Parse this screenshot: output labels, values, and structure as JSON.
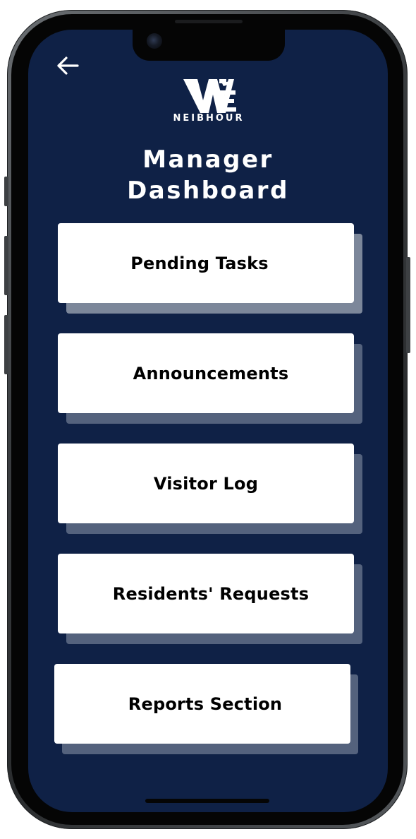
{
  "app": {
    "logo_mark": "WE",
    "logo_subtext": "NEIBHOUR"
  },
  "header": {
    "back_icon": "arrow-left-icon",
    "title_line1": "Manager",
    "title_line2": "Dashboard"
  },
  "menu": {
    "items": [
      {
        "label": "Pending Tasks"
      },
      {
        "label": "Announcements"
      },
      {
        "label": "Visitor Log"
      },
      {
        "label": "Residents' Requests"
      },
      {
        "label": "Reports Section"
      }
    ]
  },
  "colors": {
    "background": "#0f2146",
    "card": "#ffffff",
    "card_shadow": "#54627d",
    "text_on_card": "#000000",
    "text_on_background": "#ffffff"
  }
}
